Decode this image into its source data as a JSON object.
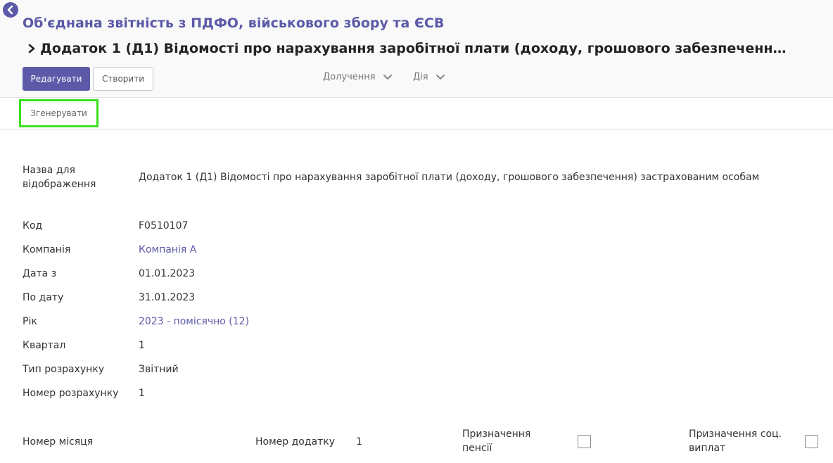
{
  "breadcrumb": {
    "parent": "Об'єднана звітність з ПДФО, військового збору та ЄСВ",
    "current": "Додаток 1 (Д1) Відомості про нарахування заробітної плати (доходу, грошового забезпечення) застрахованим особам"
  },
  "toolbar": {
    "edit_label": "Редагувати",
    "create_label": "Створити",
    "attachments_label": "Долучення",
    "action_label": "Дія"
  },
  "statusbar": {
    "generate_label": "Згенерувати"
  },
  "form": {
    "display_name": {
      "label": "Назва для відображення",
      "value": "Додаток 1 (Д1) Відомості про нарахування заробітної плати (доходу, грошового забезпечення) застрахованим особам"
    },
    "code": {
      "label": "Код",
      "value": "F0510107"
    },
    "company": {
      "label": "Компанія",
      "value": "Компанія А"
    },
    "date_from": {
      "label": "Дата з",
      "value": "01.01.2023"
    },
    "date_to": {
      "label": "По дату",
      "value": "31.01.2023"
    },
    "year": {
      "label": "Рік",
      "value": "2023 - помісячно (12)"
    },
    "quarter": {
      "label": "Квартал",
      "value": "1"
    },
    "calc_type": {
      "label": "Тип розрахунку",
      "value": "Звітний"
    },
    "calc_number": {
      "label": "Номер розрахунку",
      "value": "1"
    },
    "month_number": {
      "label": "Номер місяця",
      "value": ""
    },
    "appendix_number": {
      "label": "Номер додатку",
      "value": "1"
    },
    "pension_purpose": {
      "label": "Призначення пенсії",
      "checked": false
    },
    "social_purpose": {
      "label": "Призначення соц. виплат",
      "checked": false
    }
  },
  "icons": {
    "back": "back-arrow-icon",
    "breadcrumb_separator": "chevron-right-icon",
    "dropdown": "chevron-down-icon"
  },
  "colors": {
    "primary": "#5c5aa8",
    "highlight": "#3be01f"
  }
}
